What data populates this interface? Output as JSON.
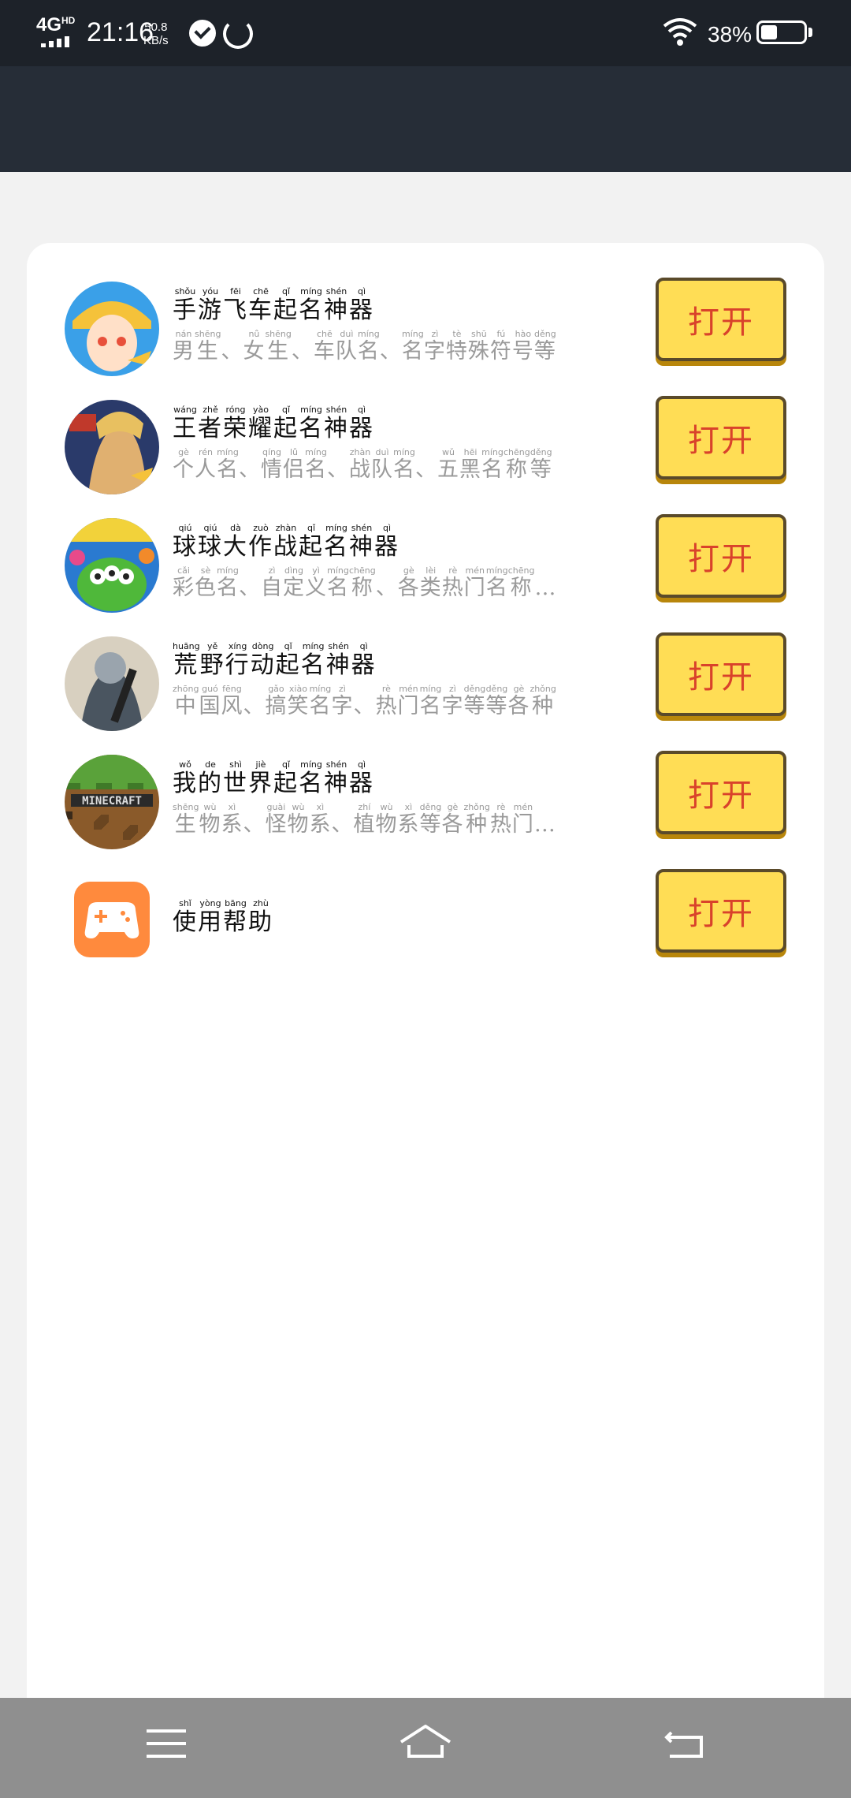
{
  "status_bar": {
    "network": "4G",
    "network_sup": "HD",
    "time": "21:16",
    "speed_value": "50.8",
    "speed_unit": "KB/s",
    "battery_pct": "38%",
    "battery_level": 0.38
  },
  "apps": [
    {
      "icon": "speed-racer-avatar-icon",
      "title": [
        [
          "手",
          "shǒu"
        ],
        [
          "游",
          "yóu"
        ],
        [
          "飞",
          "fēi"
        ],
        [
          "车",
          "chē"
        ],
        [
          "起",
          "qǐ"
        ],
        [
          "名",
          "míng"
        ],
        [
          "神",
          "shén"
        ],
        [
          "器",
          "qì"
        ]
      ],
      "subtitle": [
        [
          "男",
          "nán"
        ],
        [
          "生",
          "shēng"
        ],
        [
          "、",
          ""
        ],
        [
          "女",
          "nǚ"
        ],
        [
          "生",
          "shēng"
        ],
        [
          "、",
          ""
        ],
        [
          "车",
          "chē"
        ],
        [
          "队",
          "duì"
        ],
        [
          "名",
          "míng"
        ],
        [
          "、",
          ""
        ],
        [
          "名",
          "míng"
        ],
        [
          "字",
          "zì"
        ],
        [
          "特",
          "tè"
        ],
        [
          "殊",
          "shū"
        ],
        [
          "符",
          "fú"
        ],
        [
          "号",
          "hào"
        ],
        [
          "等",
          "děng"
        ]
      ],
      "button": "打开",
      "colors": [
        "#f5c23a",
        "#e8503a",
        "#3aa0e8"
      ]
    },
    {
      "icon": "honor-of-kings-hero-icon",
      "title": [
        [
          "王",
          "wáng"
        ],
        [
          "者",
          "zhě"
        ],
        [
          "荣",
          "róng"
        ],
        [
          "耀",
          "yào"
        ],
        [
          "起",
          "qǐ"
        ],
        [
          "名",
          "míng"
        ],
        [
          "神",
          "shén"
        ],
        [
          "器",
          "qì"
        ]
      ],
      "subtitle": [
        [
          "个",
          "gè"
        ],
        [
          "人",
          "rén"
        ],
        [
          "名",
          "míng"
        ],
        [
          "、",
          ""
        ],
        [
          "情",
          "qíng"
        ],
        [
          "侣",
          "lǚ"
        ],
        [
          "名",
          "míng"
        ],
        [
          "、",
          ""
        ],
        [
          "战",
          "zhàn"
        ],
        [
          "队",
          "duì"
        ],
        [
          "名",
          "míng"
        ],
        [
          "、",
          ""
        ],
        [
          "五",
          "wǔ"
        ],
        [
          "黑",
          "hēi"
        ],
        [
          "名",
          "míng"
        ],
        [
          "称",
          "chēng"
        ],
        [
          "等",
          "děng"
        ]
      ],
      "button": "打开",
      "colors": [
        "#2a3a6a",
        "#e0b070",
        "#c0392b"
      ]
    },
    {
      "icon": "ball-battle-monster-icon",
      "title": [
        [
          "球",
          "qiú"
        ],
        [
          "球",
          "qiú"
        ],
        [
          "大",
          "dà"
        ],
        [
          "作",
          "zuò"
        ],
        [
          "战",
          "zhàn"
        ],
        [
          "起",
          "qǐ"
        ],
        [
          "名",
          "míng"
        ],
        [
          "神",
          "shén"
        ],
        [
          "器",
          "qì"
        ]
      ],
      "subtitle": [
        [
          "彩",
          "cǎi"
        ],
        [
          "色",
          "sè"
        ],
        [
          "名",
          "míng"
        ],
        [
          "、",
          ""
        ],
        [
          "自",
          "zì"
        ],
        [
          "定",
          "dìng"
        ],
        [
          "义",
          "yì"
        ],
        [
          "名",
          "míng"
        ],
        [
          "称",
          "chēng"
        ],
        [
          "、",
          ""
        ],
        [
          "各",
          "gè"
        ],
        [
          "类",
          "lèi"
        ],
        [
          "热",
          "rè"
        ],
        [
          "门",
          "mén"
        ],
        [
          "名",
          "míng"
        ],
        [
          "称",
          "chēng"
        ],
        [
          "…",
          ""
        ]
      ],
      "button": "打开",
      "colors": [
        "#4fb83a",
        "#2a7ad0",
        "#f2d23a"
      ]
    },
    {
      "icon": "rules-of-survival-soldier-icon",
      "title": [
        [
          "荒",
          "huāng"
        ],
        [
          "野",
          "yě"
        ],
        [
          "行",
          "xíng"
        ],
        [
          "动",
          "dòng"
        ],
        [
          "起",
          "qǐ"
        ],
        [
          "名",
          "míng"
        ],
        [
          "神",
          "shén"
        ],
        [
          "器",
          "qì"
        ]
      ],
      "subtitle": [
        [
          "中",
          "zhōng"
        ],
        [
          "国",
          "guó"
        ],
        [
          "风",
          "fēng"
        ],
        [
          "、",
          ""
        ],
        [
          "搞",
          "gǎo"
        ],
        [
          "笑",
          "xiào"
        ],
        [
          "名",
          "míng"
        ],
        [
          "字",
          "zì"
        ],
        [
          "、",
          ""
        ],
        [
          "热",
          "rè"
        ],
        [
          "门",
          "mén"
        ],
        [
          "名",
          "míng"
        ],
        [
          "字",
          "zì"
        ],
        [
          "等",
          "děng"
        ],
        [
          "等",
          "děng"
        ],
        [
          "各",
          "gè"
        ],
        [
          "种",
          "zhǒng"
        ]
      ],
      "button": "打开",
      "colors": [
        "#9aa4ad",
        "#4a5560",
        "#d8d0c0"
      ]
    },
    {
      "icon": "minecraft-block-icon",
      "title": [
        [
          "我",
          "wǒ"
        ],
        [
          "的",
          "de"
        ],
        [
          "世",
          "shì"
        ],
        [
          "界",
          "jiè"
        ],
        [
          "起",
          "qǐ"
        ],
        [
          "名",
          "míng"
        ],
        [
          "神",
          "shén"
        ],
        [
          "器",
          "qì"
        ]
      ],
      "subtitle": [
        [
          "生",
          "shēng"
        ],
        [
          "物",
          "wù"
        ],
        [
          "系",
          "xì"
        ],
        [
          "、",
          ""
        ],
        [
          "怪",
          "guài"
        ],
        [
          "物",
          "wù"
        ],
        [
          "系",
          "xì"
        ],
        [
          "、",
          ""
        ],
        [
          "植",
          "zhí"
        ],
        [
          "物",
          "wù"
        ],
        [
          "系",
          "xì"
        ],
        [
          "等",
          "děng"
        ],
        [
          "各",
          "gè"
        ],
        [
          "种",
          "zhǒng"
        ],
        [
          "热",
          "rè"
        ],
        [
          "门",
          "mén"
        ],
        [
          "…",
          ""
        ]
      ],
      "button": "打开",
      "colors": [
        "#5aa23a",
        "#8a5a2a",
        "#3a2a1a"
      ]
    },
    {
      "icon": "gamepad-help-icon",
      "title": [
        [
          "使",
          "shǐ"
        ],
        [
          "用",
          "yòng"
        ],
        [
          "帮",
          "bāng"
        ],
        [
          "助",
          "zhù"
        ]
      ],
      "subtitle": [],
      "button": "打开",
      "colors": [
        "#ff8a3d"
      ]
    }
  ],
  "nav_bar": {
    "menu": "menu-icon",
    "home": "home-icon",
    "back": "back-icon"
  }
}
